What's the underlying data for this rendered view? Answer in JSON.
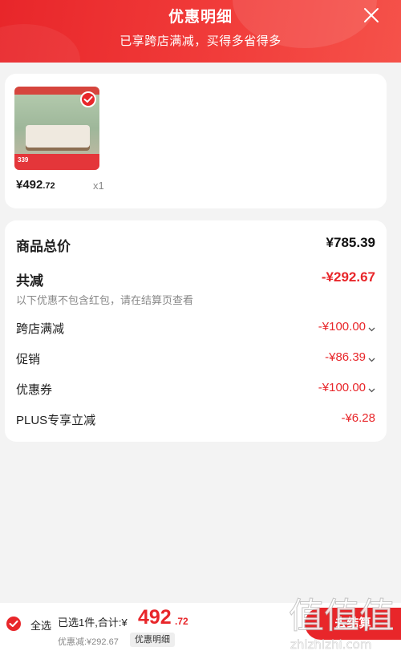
{
  "header": {
    "title": "优惠明细",
    "subtitle": "已享跨店满减，买得多省得多"
  },
  "product": {
    "price_int": "¥492",
    "price_dec": ".72",
    "qty": "x1",
    "thumb_price": "339"
  },
  "summary": {
    "total_label": "商品总价",
    "total_value": "¥785.39",
    "reduce_label": "共减",
    "reduce_value": "-¥292.67",
    "note": "以下优惠不包含红包，请在结算页查看",
    "items": [
      {
        "label": "跨店满减",
        "value": "-¥100.00"
      },
      {
        "label": "促销",
        "value": "-¥86.39"
      },
      {
        "label": "优惠券",
        "value": "-¥100.00"
      },
      {
        "label": "PLUS专享立减",
        "value": "-¥6.28"
      }
    ]
  },
  "bottom": {
    "select_all": "全选",
    "selected_text": "已选1件,合计:¥",
    "total_int": "492",
    "total_dec": ".72",
    "discount_note": "优惠减:¥292.67",
    "detail_link": "优惠明细",
    "checkout": "去结算"
  },
  "watermark": {
    "line1": "值",
    "line2": "zhizhizhi.com"
  },
  "colors": {
    "accent": "#e8262a",
    "background": "#f3f3f3"
  }
}
